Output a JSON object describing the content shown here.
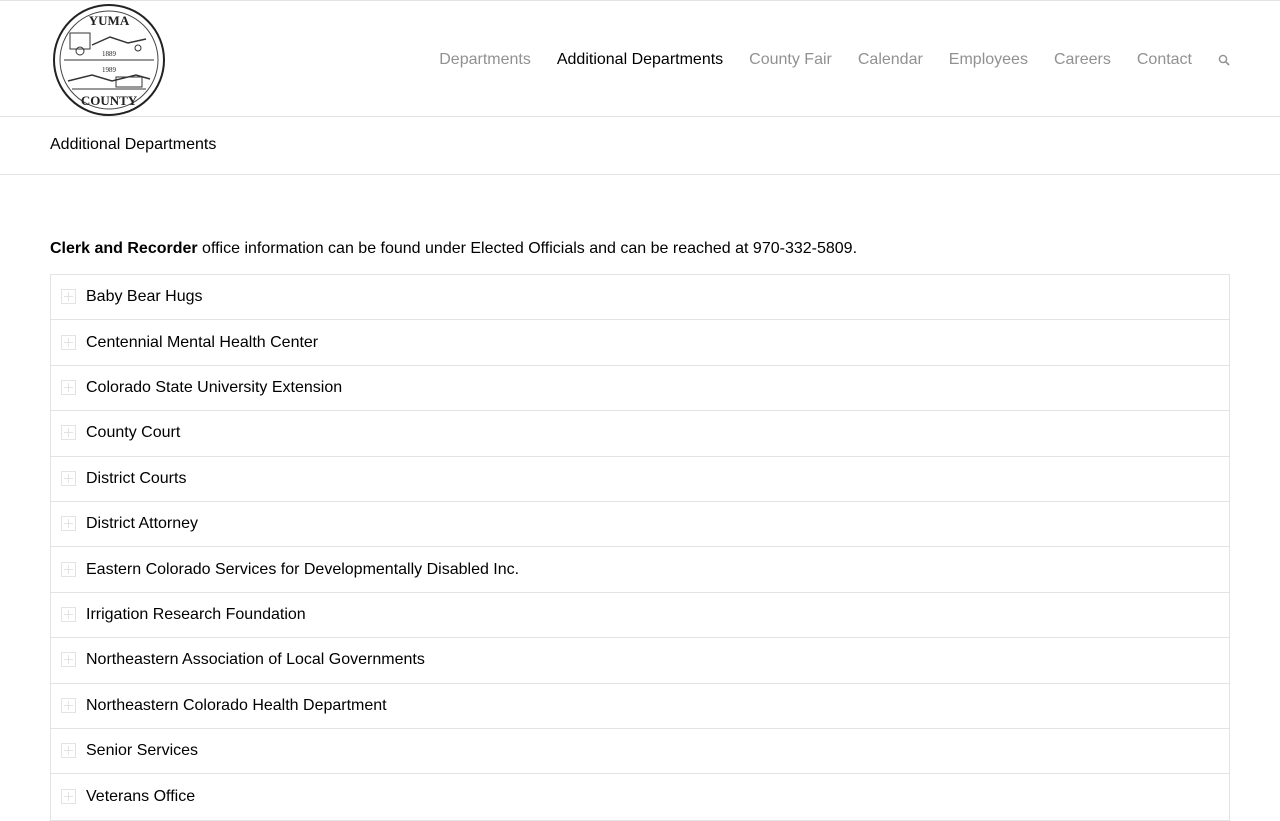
{
  "header": {
    "logo": {
      "icon": "yuma-county-seal",
      "text_top": "YUMA",
      "text_bottom": "COUNTY",
      "year_1": "1889",
      "year_2": "1989"
    },
    "nav": {
      "items": [
        {
          "label": "Departments",
          "active": false
        },
        {
          "label": "Additional Departments",
          "active": true
        },
        {
          "label": "County Fair",
          "active": false
        },
        {
          "label": "Calendar",
          "active": false
        },
        {
          "label": "Employees",
          "active": false
        },
        {
          "label": "Careers",
          "active": false
        },
        {
          "label": "Contact",
          "active": false
        }
      ],
      "search_icon": "search-icon"
    }
  },
  "title_bar": {
    "title": "Additional Departments"
  },
  "intro": {
    "bold": "Clerk and Recorder",
    "text": " office information can be found under Elected Officials and can be reached at 970-332-5809."
  },
  "accordion": {
    "items": [
      {
        "label": "Baby Bear Hugs"
      },
      {
        "label": "Centennial Mental Health Center"
      },
      {
        "label": "Colorado State University Extension"
      },
      {
        "label": "County Court"
      },
      {
        "label": "District Courts"
      },
      {
        "label": "District Attorney"
      },
      {
        "label": "Eastern Colorado Services for Developmentally Disabled Inc."
      },
      {
        "label": "Irrigation Research Foundation"
      },
      {
        "label": "Northeastern Association of Local Governments"
      },
      {
        "label": "Northeastern Colorado Health Department"
      },
      {
        "label": "Senior Services"
      },
      {
        "label": "Veterans Office"
      }
    ],
    "toggle_icon": "plus-icon"
  },
  "colors": {
    "nav_inactive": "#919191",
    "nav_active": "#000000",
    "border": "#e3e3e3",
    "background": "#ffffff"
  }
}
